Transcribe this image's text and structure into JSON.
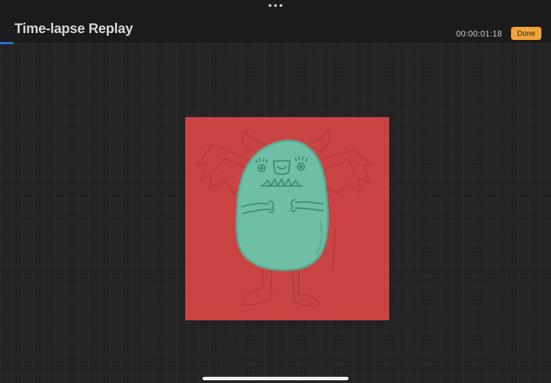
{
  "header": {
    "title": "Time-lapse Replay",
    "timer": "00:00:01:18",
    "done_label": "Done",
    "playback_progress": 0.025
  },
  "canvas": {
    "background_color": "#c94343",
    "figure_color": "#6fbfa6",
    "sketch_color": "#b63d3d"
  },
  "colors": {
    "accent": "#f3a33a",
    "progress": "#2f6fe0",
    "app_background": "#232323"
  },
  "icons": {
    "more": "more-dots-icon"
  }
}
